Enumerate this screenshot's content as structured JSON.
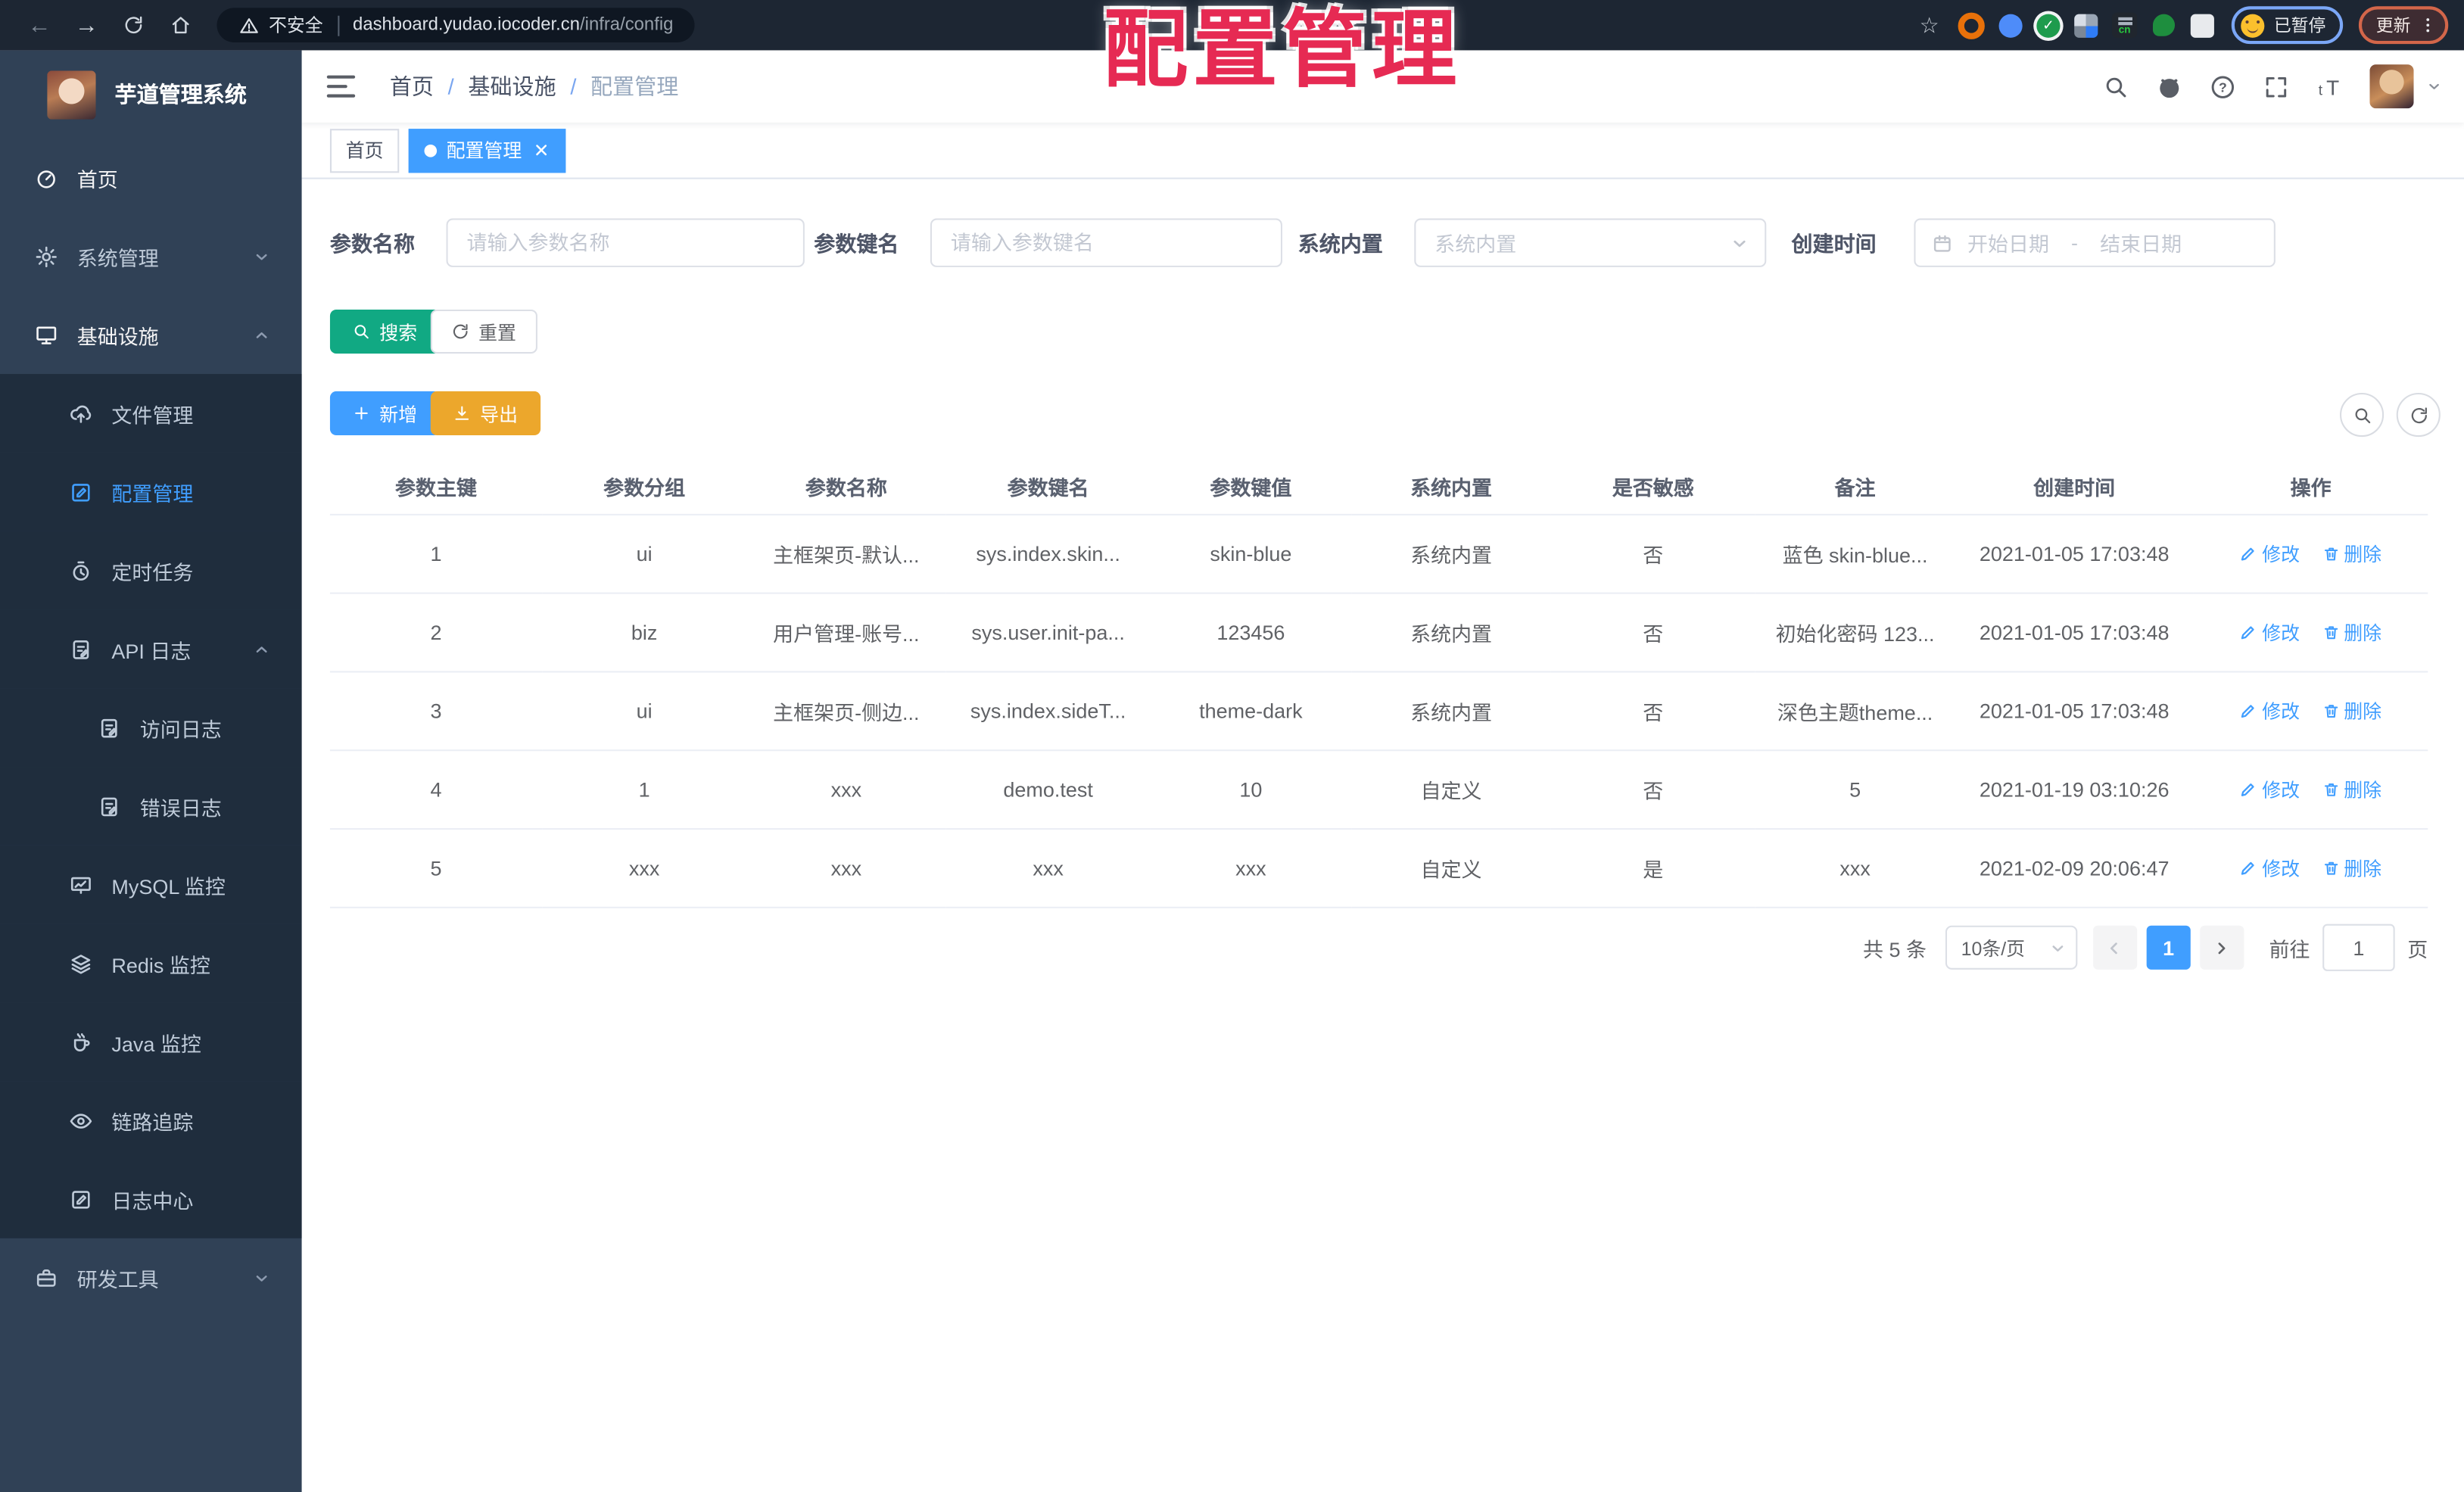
{
  "colors": {
    "accent": "#409eff",
    "teal": "#11a983",
    "warn": "#eca72c",
    "sidebar": "#304156",
    "submenu": "#1f2d3d",
    "red": "#e62a53"
  },
  "overlay_title": "配置管理",
  "browser": {
    "security_label": "不安全",
    "url_domain": "dashboard.yudao.iocoder.cn",
    "url_path": "/infra/config",
    "ext_cn_label": "cn",
    "paused_label": "已暂停",
    "update_label": "更新"
  },
  "sidebar": {
    "app_title": "芋道管理系统",
    "items": [
      {
        "label": "首页",
        "icon": "gauge",
        "level": 1,
        "bright": true
      },
      {
        "label": "系统管理",
        "icon": "gear",
        "level": 1,
        "chevron": "chevron-down"
      },
      {
        "label": "基础设施",
        "icon": "monitor",
        "level": 1,
        "bright": true,
        "chevron": "chevron-up"
      },
      {
        "label": "文件管理",
        "icon": "cloud-upload",
        "level": 2,
        "sub": true
      },
      {
        "label": "配置管理",
        "icon": "edit-square",
        "level": 2,
        "sub": true,
        "active": true
      },
      {
        "label": "定时任务",
        "icon": "timer",
        "level": 2,
        "sub": true
      },
      {
        "label": "API 日志",
        "icon": "doc-edit",
        "level": 2,
        "sub": true,
        "chevron": "chevron-up"
      },
      {
        "label": "访问日志",
        "icon": "doc-edit",
        "level": 3,
        "sub": true
      },
      {
        "label": "错误日志",
        "icon": "doc-edit",
        "level": 3,
        "sub": true
      },
      {
        "label": "MySQL 监控",
        "icon": "mysql",
        "level": 2,
        "sub": true
      },
      {
        "label": "Redis 监控",
        "icon": "layers",
        "level": 2,
        "sub": true
      },
      {
        "label": "Java 监控",
        "icon": "java",
        "level": 2,
        "sub": true
      },
      {
        "label": "链路追踪",
        "icon": "eye",
        "level": 2,
        "sub": true
      },
      {
        "label": "日志中心",
        "icon": "edit-square",
        "level": 2,
        "sub": true
      },
      {
        "label": "研发工具",
        "icon": "briefcase",
        "level": 1,
        "chevron": "chevron-down"
      }
    ]
  },
  "header": {
    "breadcrumb": [
      "首页",
      "基础设施",
      "配置管理"
    ],
    "breadcrumb_separator": "/"
  },
  "tabs": [
    {
      "label": "首页",
      "active": false
    },
    {
      "label": "配置管理",
      "active": true
    }
  ],
  "filters": {
    "name_label": "参数名称",
    "name_placeholder": "请输入参数名称",
    "key_label": "参数键名",
    "key_placeholder": "请输入参数键名",
    "type_label": "系统内置",
    "type_placeholder": "系统内置",
    "date_label": "创建时间",
    "date_start_placeholder": "开始日期",
    "date_separator": "-",
    "date_end_placeholder": "结束日期",
    "search_label": "搜索",
    "reset_label": "重置"
  },
  "toolbar": {
    "add_label": "新增",
    "export_label": "导出"
  },
  "table": {
    "columns": [
      "参数主键",
      "参数分组",
      "参数名称",
      "参数键名",
      "参数键值",
      "系统内置",
      "是否敏感",
      "备注",
      "创建时间",
      "操作"
    ],
    "rows": [
      [
        "1",
        "ui",
        "主框架页-默认...",
        "sys.index.skin...",
        "skin-blue",
        "系统内置",
        "否",
        "蓝色 skin-blue...",
        "2021-01-05 17:03:48"
      ],
      [
        "2",
        "biz",
        "用户管理-账号...",
        "sys.user.init-pa...",
        "123456",
        "系统内置",
        "否",
        "初始化密码 123...",
        "2021-01-05 17:03:48"
      ],
      [
        "3",
        "ui",
        "主框架页-侧边...",
        "sys.index.sideT...",
        "theme-dark",
        "系统内置",
        "否",
        "深色主题theme...",
        "2021-01-05 17:03:48"
      ],
      [
        "4",
        "1",
        "xxx",
        "demo.test",
        "10",
        "自定义",
        "否",
        "5",
        "2021-01-19 03:10:26"
      ],
      [
        "5",
        "xxx",
        "xxx",
        "xxx",
        "xxx",
        "自定义",
        "是",
        "xxx",
        "2021-02-09 20:06:47"
      ]
    ],
    "edit_label": "修改",
    "delete_label": "删除"
  },
  "pagination": {
    "total": "共 5 条",
    "page_size": "10条/页",
    "current": "1",
    "goto_label": "前往",
    "goto_value": "1",
    "page_label": "页"
  }
}
